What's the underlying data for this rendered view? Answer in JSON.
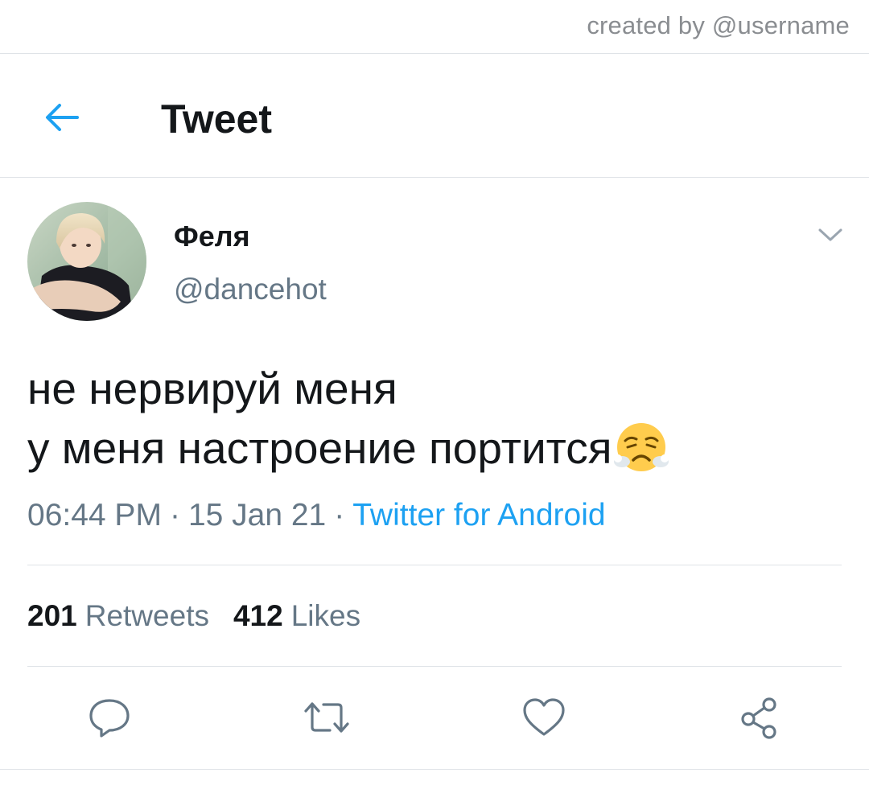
{
  "credit": "created by @username",
  "header": {
    "title": "Tweet",
    "back_icon": "arrow-left-icon",
    "accent_color": "#1da1f2"
  },
  "tweet": {
    "display_name": "Феля",
    "handle": "@dancehot",
    "lines": [
      "не нервируй меня",
      "у меня настроение портится"
    ],
    "emoji": "face-with-steam-from-nose",
    "time": "06:44 PM",
    "separator": "·",
    "date": "15 Jan 21",
    "source": "Twitter for Android"
  },
  "stats": {
    "retweets_count": "201",
    "retweets_label": "Retweets",
    "likes_count": "412",
    "likes_label": "Likes"
  },
  "actions": {
    "reply_icon": "reply-icon",
    "retweet_icon": "retweet-icon",
    "like_icon": "heart-icon",
    "share_icon": "share-icon"
  }
}
